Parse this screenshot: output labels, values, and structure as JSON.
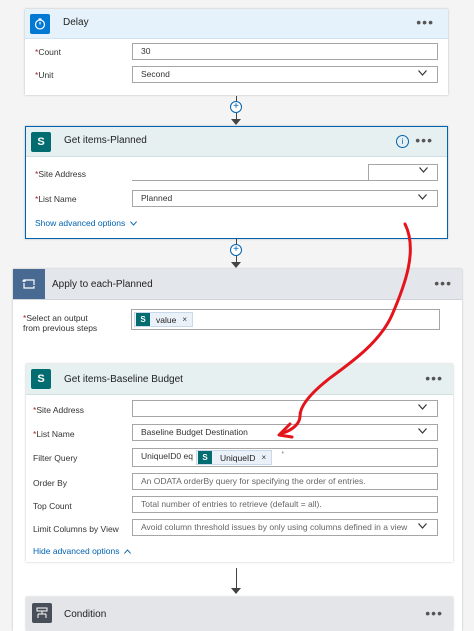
{
  "delay": {
    "title": "Delay",
    "count_label": "Count",
    "count_value": "30",
    "unit_label": "Unit",
    "unit_value": "Second"
  },
  "get_items_planned": {
    "title": "Get items-Planned",
    "site_label": "Site Address",
    "site_value": "",
    "list_label": "List Name",
    "list_value": "Planned",
    "advanced_link": "Show advanced options"
  },
  "apply_each": {
    "title": "Apply to each-Planned",
    "select_label_1": "Select an output",
    "select_label_2": "from previous steps",
    "token_label": "value",
    "token_remove": "×"
  },
  "get_items_baseline": {
    "title": "Get items-Baseline Budget",
    "site_label": "Site Address",
    "list_label": "List Name",
    "list_value": "Baseline Budget Destination",
    "filter_label": "Filter Query",
    "filter_prefix": "UniqueID0 eq",
    "filter_token": "UniqueID",
    "filter_token_remove": "×",
    "filter_suffix": "'",
    "order_label": "Order By",
    "order_placeholder": "An ODATA orderBy query for specifying the order of entries.",
    "top_label": "Top Count",
    "top_placeholder": "Total number of entries to retrieve (default = all).",
    "limit_label": "Limit Columns by View",
    "limit_placeholder": "Avoid column threshold issues by only using columns defined in a view",
    "hide_link": "Hide advanced options"
  },
  "condition": {
    "title": "Condition"
  },
  "required_mark": "*",
  "menu_glyph": "•••",
  "plus_glyph": "+",
  "info_glyph": "i",
  "colors": {
    "delay_accent": "#0078d4",
    "sharepoint": "#036c70",
    "loop_accent": "#486991",
    "condition_accent": "#484f58",
    "selected_border": "#0062b1",
    "annotation_red": "#e3141c"
  },
  "icons": [
    "timer-icon",
    "sharepoint-icon",
    "loop-icon",
    "condition-icon",
    "chevron-down-icon",
    "more-options-icon",
    "info-icon",
    "add-step-icon",
    "remove-token-icon"
  ]
}
